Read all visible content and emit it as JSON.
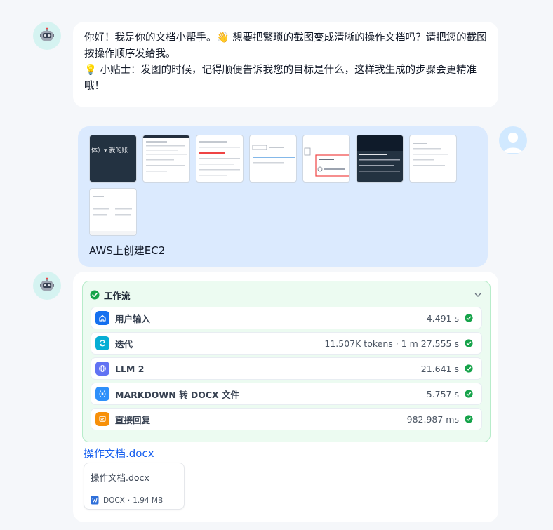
{
  "assistant_intro": {
    "line1": "你好！我是你的文档小帮手。👋 想要把繁琐的截图变成清晰的操作文档吗？请把您的截图按操作顺序发给我。",
    "line2": "💡 小贴士：发图的时候，记得顺便告诉我您的目标是什么，这样我生成的步骤会更精准哦！"
  },
  "user_message": {
    "text": "AWS上创建EC2",
    "thumbnail_count": 8
  },
  "workflow": {
    "title": "工作流",
    "status": "success",
    "nodes": [
      {
        "label": "用户输入",
        "time": "4.491 s",
        "icon": "home-icon",
        "color": "#1570ef"
      },
      {
        "label": "迭代",
        "time": "11.507K tokens · 1 m 27.555 s",
        "icon": "loop-icon",
        "color": "#06aed4"
      },
      {
        "label": "LLM 2",
        "time": "21.641 s",
        "icon": "llm-icon",
        "color": "#6172f3"
      },
      {
        "label": "MARKDOWN 转 DOCX 文件",
        "time": "5.757 s",
        "icon": "code-icon",
        "color": "#2e90fa"
      },
      {
        "label": "直接回复",
        "time": "982.987 ms",
        "icon": "reply-icon",
        "color": "#f79009"
      }
    ]
  },
  "output": {
    "link_text": "操作文档.docx",
    "file": {
      "name": "操作文档.docx",
      "type": "DOCX",
      "size": "1.94 MB"
    }
  },
  "colors": {
    "success": "#16a34a",
    "link": "#155eef"
  }
}
